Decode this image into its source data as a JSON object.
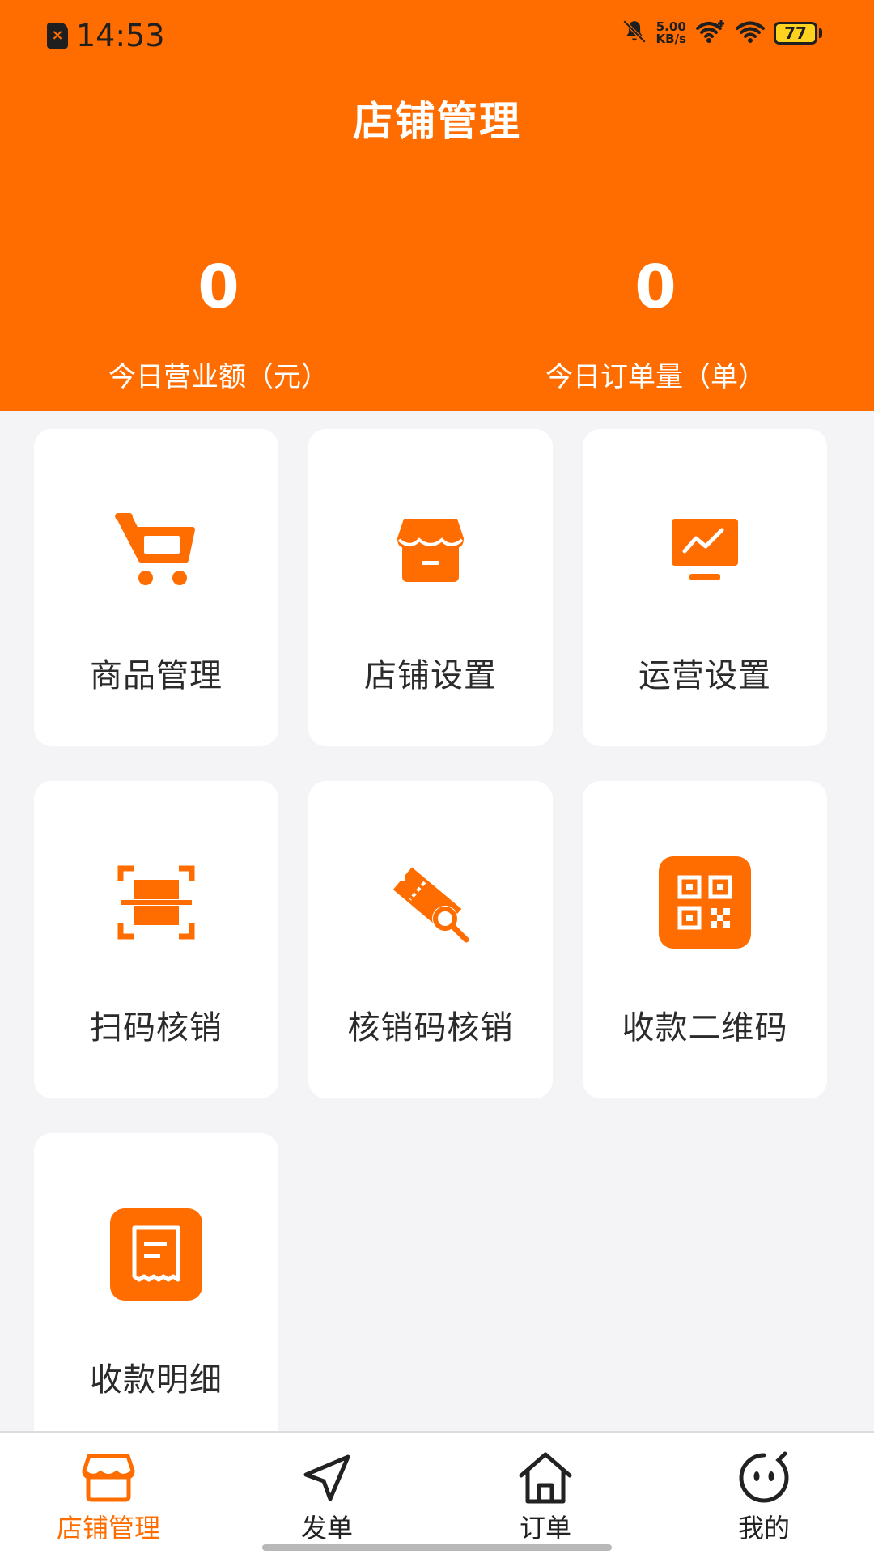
{
  "status_bar": {
    "time": "14:53",
    "network_speed_value": "5.00",
    "network_speed_unit": "KB/s",
    "battery": "77"
  },
  "header": {
    "title": "店铺管理",
    "stats": [
      {
        "value": "0",
        "label": "今日营业额（元）"
      },
      {
        "value": "0",
        "label": "今日订单量（单）"
      }
    ]
  },
  "menu": [
    {
      "label": "商品管理",
      "icon": "shopping-cart-icon"
    },
    {
      "label": "店铺设置",
      "icon": "store-icon"
    },
    {
      "label": "运营设置",
      "icon": "monitor-chart-icon"
    },
    {
      "label": "扫码核销",
      "icon": "scan-icon"
    },
    {
      "label": "核销码核销",
      "icon": "ticket-search-icon"
    },
    {
      "label": "收款二维码",
      "icon": "qr-code-icon"
    },
    {
      "label": "收款明细",
      "icon": "receipt-icon"
    }
  ],
  "tabbar": {
    "active_color": "#ff6d00",
    "items": [
      {
        "label": "店铺管理",
        "icon": "store-icon",
        "active": true
      },
      {
        "label": "发单",
        "icon": "send-icon",
        "active": false
      },
      {
        "label": "订单",
        "icon": "home-icon",
        "active": false
      },
      {
        "label": "我的",
        "icon": "smiley-icon",
        "active": false
      }
    ]
  },
  "colors": {
    "brand": "#ff6d00",
    "background": "#f4f4f6"
  }
}
